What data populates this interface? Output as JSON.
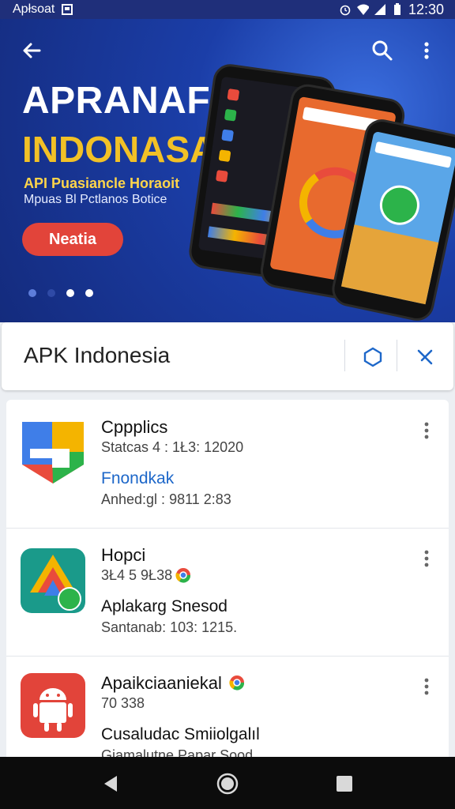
{
  "status_bar": {
    "app_label": "Apłsoat",
    "time": "12:30"
  },
  "hero": {
    "title_line1": "APRANAFIK",
    "title_line2": "INDONASAI",
    "subtitle_line1": "API Puasiancle Horaoit",
    "subtitle_line2": "Mpuas Bl Pctlanos Botice",
    "cta_label": "Neatia",
    "carousel_dots": 4,
    "carousel_active_index": 2
  },
  "search_bar": {
    "title": "APK Indonesia"
  },
  "apps": [
    {
      "name": "Cppplics",
      "meta1": "Statcas 4 : 1Ł3: 12020",
      "subtitle": "Fnondkak",
      "meta2": "Anhed:gl : 9811 2:83",
      "subtitle_color": "#1d67c9",
      "badge": null
    },
    {
      "name": "Hopci",
      "meta1": "3Ł4 5 9Ł38",
      "subtitle": "Aplakarg Snesod",
      "meta2": "Santanab: 103: 1215.",
      "subtitle_color": "#111111",
      "badge": "chrome-badge-icon"
    },
    {
      "name": "Apaikciaaniekal",
      "meta1": "70 338",
      "subtitle": "Cusaludac Smiiolgalıl",
      "meta2": "Giamalutne Papar Sood",
      "subtitle_color": "#111111",
      "badge": "chrome-badge-icon"
    }
  ],
  "colors": {
    "accent": "#e2443a",
    "hero_bg": "#1b3ea8",
    "yellow": "#f2c126",
    "link": "#1d67c9"
  }
}
